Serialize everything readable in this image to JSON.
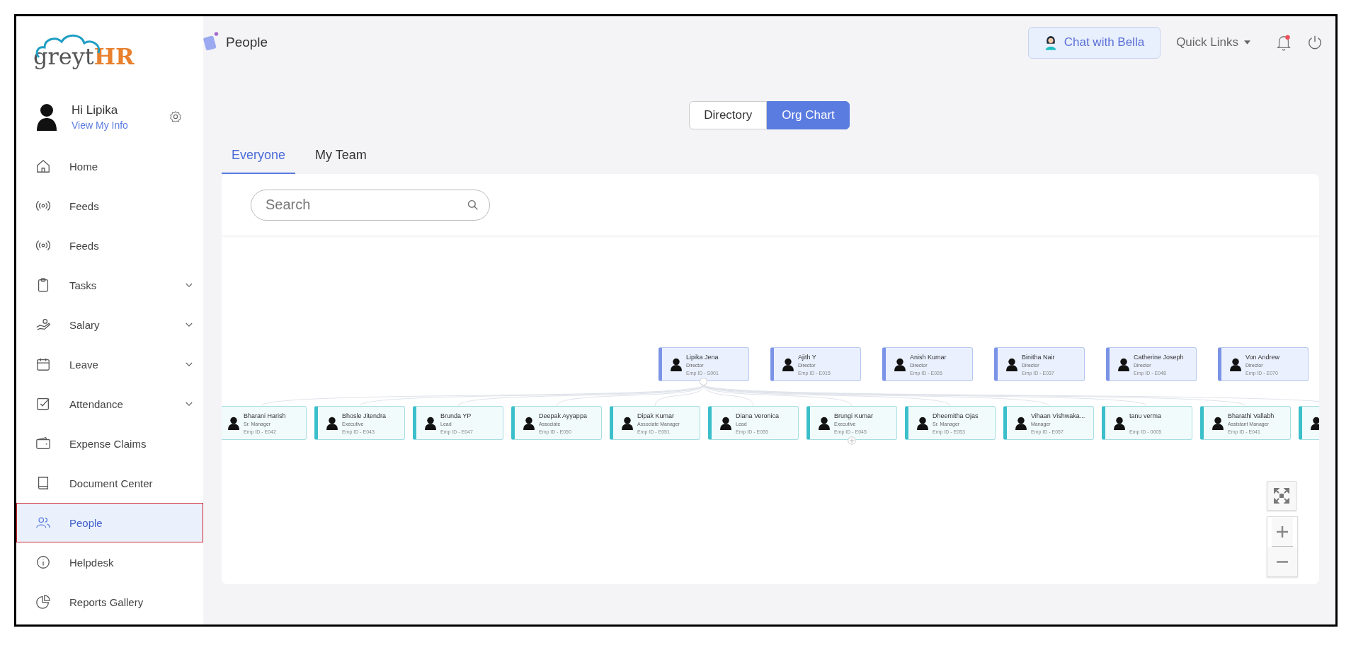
{
  "sidebar": {
    "logo": {
      "part_1": "greyt",
      "part_2": "HR"
    },
    "user": {
      "greeting": "Hi Lipika",
      "link": "View My Info"
    },
    "items": [
      {
        "label": "Home",
        "expandable": false,
        "selected": false
      },
      {
        "label": "Feeds",
        "expandable": false,
        "selected": false
      },
      {
        "label": "Feeds",
        "expandable": false,
        "selected": false
      },
      {
        "label": "Tasks",
        "expandable": true,
        "selected": false
      },
      {
        "label": "Salary",
        "expandable": true,
        "selected": false
      },
      {
        "label": "Leave",
        "expandable": true,
        "selected": false
      },
      {
        "label": "Attendance",
        "expandable": true,
        "selected": false
      },
      {
        "label": "Expense Claims",
        "expandable": false,
        "selected": false
      },
      {
        "label": "Document Center",
        "expandable": false,
        "selected": false
      },
      {
        "label": "People",
        "expandable": false,
        "selected": true
      },
      {
        "label": "Helpdesk",
        "expandable": false,
        "selected": false
      },
      {
        "label": "Reports Gallery",
        "expandable": false,
        "selected": false
      }
    ]
  },
  "header": {
    "title": "People",
    "chat_button": "Chat with Bella",
    "quick_links": "Quick Links",
    "notifications_unread": true
  },
  "view_toggle": [
    {
      "label": "Directory",
      "selected": false
    },
    {
      "label": "Org Chart",
      "selected": true
    }
  ],
  "tabs": [
    {
      "label": "Everyone",
      "selected": true
    },
    {
      "label": "My Team",
      "selected": false
    }
  ],
  "search": {
    "placeholder": "Search"
  },
  "org_chart": {
    "top_row": [
      {
        "name": "Lipika Jena",
        "role": "Director",
        "emp_id": "Emp ID - S001",
        "expanded": true
      },
      {
        "name": "Ajith Y",
        "role": "Director",
        "emp_id": "Emp ID - E015",
        "expanded": false
      },
      {
        "name": "Anish Kumar",
        "role": "Director",
        "emp_id": "Emp ID - E026",
        "expanded": false
      },
      {
        "name": "Binitha Nair",
        "role": "Director",
        "emp_id": "Emp ID - E037",
        "expanded": false
      },
      {
        "name": "Catherine Joseph",
        "role": "Director",
        "emp_id": "Emp ID - E048",
        "expanded": false
      },
      {
        "name": "Von Andrew",
        "role": "Director",
        "emp_id": "Emp ID - E070",
        "expanded": false
      }
    ],
    "reports": [
      {
        "name": "Bharani Harish",
        "role": "Sr. Manager",
        "emp_id": "Emp ID - E042",
        "expandable": false
      },
      {
        "name": "Bhosle Jitendra",
        "role": "Executive",
        "emp_id": "Emp ID - E043",
        "expandable": false
      },
      {
        "name": "Brunda YP",
        "role": "Lead",
        "emp_id": "Emp ID - E047",
        "expandable": false
      },
      {
        "name": "Deepak Ayyappa",
        "role": "Associate",
        "emp_id": "Emp ID - E050",
        "expandable": false
      },
      {
        "name": "Dipak Kumar",
        "role": "Associate Manager",
        "emp_id": "Emp ID - E051",
        "expandable": false
      },
      {
        "name": "Diana Veronica",
        "role": "Lead",
        "emp_id": "Emp ID - E055",
        "expandable": false
      },
      {
        "name": "Brungi Kumar",
        "role": "Executive",
        "emp_id": "Emp ID - E045",
        "expandable": true
      },
      {
        "name": "Dheemitha Ojas",
        "role": "Sr. Manager",
        "emp_id": "Emp ID - E053",
        "expandable": false
      },
      {
        "name": "Vihaan Vishwaka...",
        "role": "Manager",
        "emp_id": "Emp ID - E057",
        "expandable": false
      },
      {
        "name": "tanu verma",
        "emp_id": "Emp ID - 0005",
        "expandable": false
      },
      {
        "name": "Bharathi Vallabh",
        "role": "Assistant Manager",
        "emp_id": "Emp ID - E041",
        "expandable": false
      }
    ]
  }
}
